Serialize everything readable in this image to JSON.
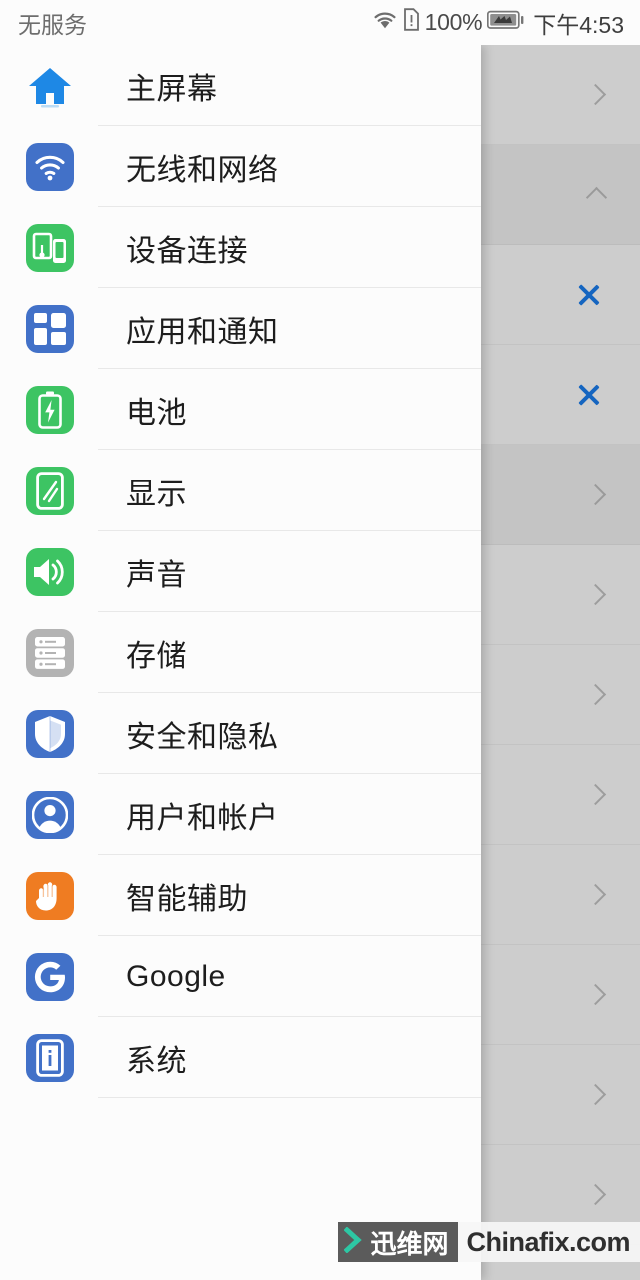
{
  "status_bar": {
    "carrier": "无服务",
    "battery_percent": "100%",
    "clock": "下午4:53",
    "icons": [
      "wifi-icon",
      "sim-alert-icon",
      "battery-icon"
    ]
  },
  "drawer": {
    "items": [
      {
        "label": "主屏幕",
        "icon": "home-icon",
        "icon_style": "plain-blue"
      },
      {
        "label": "无线和网络",
        "icon": "wifi-icon",
        "icon_style": "tile-blue"
      },
      {
        "label": "设备连接",
        "icon": "device-connect-icon",
        "icon_style": "tile-green"
      },
      {
        "label": "应用和通知",
        "icon": "apps-grid-icon",
        "icon_style": "tile-blue"
      },
      {
        "label": "电池",
        "icon": "battery-icon",
        "icon_style": "tile-green"
      },
      {
        "label": "显示",
        "icon": "display-icon",
        "icon_style": "tile-green"
      },
      {
        "label": "声音",
        "icon": "sound-speaker-icon",
        "icon_style": "tile-green"
      },
      {
        "label": "存储",
        "icon": "storage-icon",
        "icon_style": "tile-gray"
      },
      {
        "label": "安全和隐私",
        "icon": "shield-icon",
        "icon_style": "tile-blue"
      },
      {
        "label": "用户和帐户",
        "icon": "user-account-icon",
        "icon_style": "tile-blue"
      },
      {
        "label": "智能辅助",
        "icon": "hand-assist-icon",
        "icon_style": "tile-orange"
      },
      {
        "label": "Google",
        "icon": "google-g-icon",
        "icon_style": "tile-blue"
      },
      {
        "label": "系统",
        "icon": "system-info-icon",
        "icon_style": "tile-blue"
      }
    ]
  },
  "background_list": {
    "rows": [
      {
        "accessory": "chevron-right-icon",
        "shaded": false
      },
      {
        "accessory": "chevron-up-icon",
        "shaded": true
      },
      {
        "accessory": "close-x-icon",
        "shaded": false
      },
      {
        "accessory": "close-x-icon",
        "shaded": false
      },
      {
        "accessory": "chevron-right-icon",
        "shaded": true
      },
      {
        "accessory": "chevron-right-icon",
        "shaded": false
      },
      {
        "accessory": "chevron-right-icon",
        "shaded": false
      },
      {
        "accessory": "chevron-right-icon",
        "shaded": false
      },
      {
        "accessory": "chevron-right-icon",
        "shaded": false
      },
      {
        "accessory": "chevron-right-icon",
        "shaded": false
      },
      {
        "accessory": "chevron-right-icon",
        "shaded": false
      },
      {
        "accessory": "chevron-right-icon",
        "shaded": false
      }
    ]
  },
  "watermark": {
    "cn_text": "迅维网",
    "en_text": "Chinafix.com",
    "chevron_color": "#2dc7a4",
    "box_color": "#5b5b5b"
  },
  "colors": {
    "accent_blue": "#1565c0",
    "tile_blue": "#4271c8",
    "tile_green": "#3dc463",
    "tile_gray": "#b3b3b3",
    "tile_orange": "#ef7c22",
    "scrim": "#cdcdcd",
    "drawer_bg": "#fcfcfc"
  }
}
